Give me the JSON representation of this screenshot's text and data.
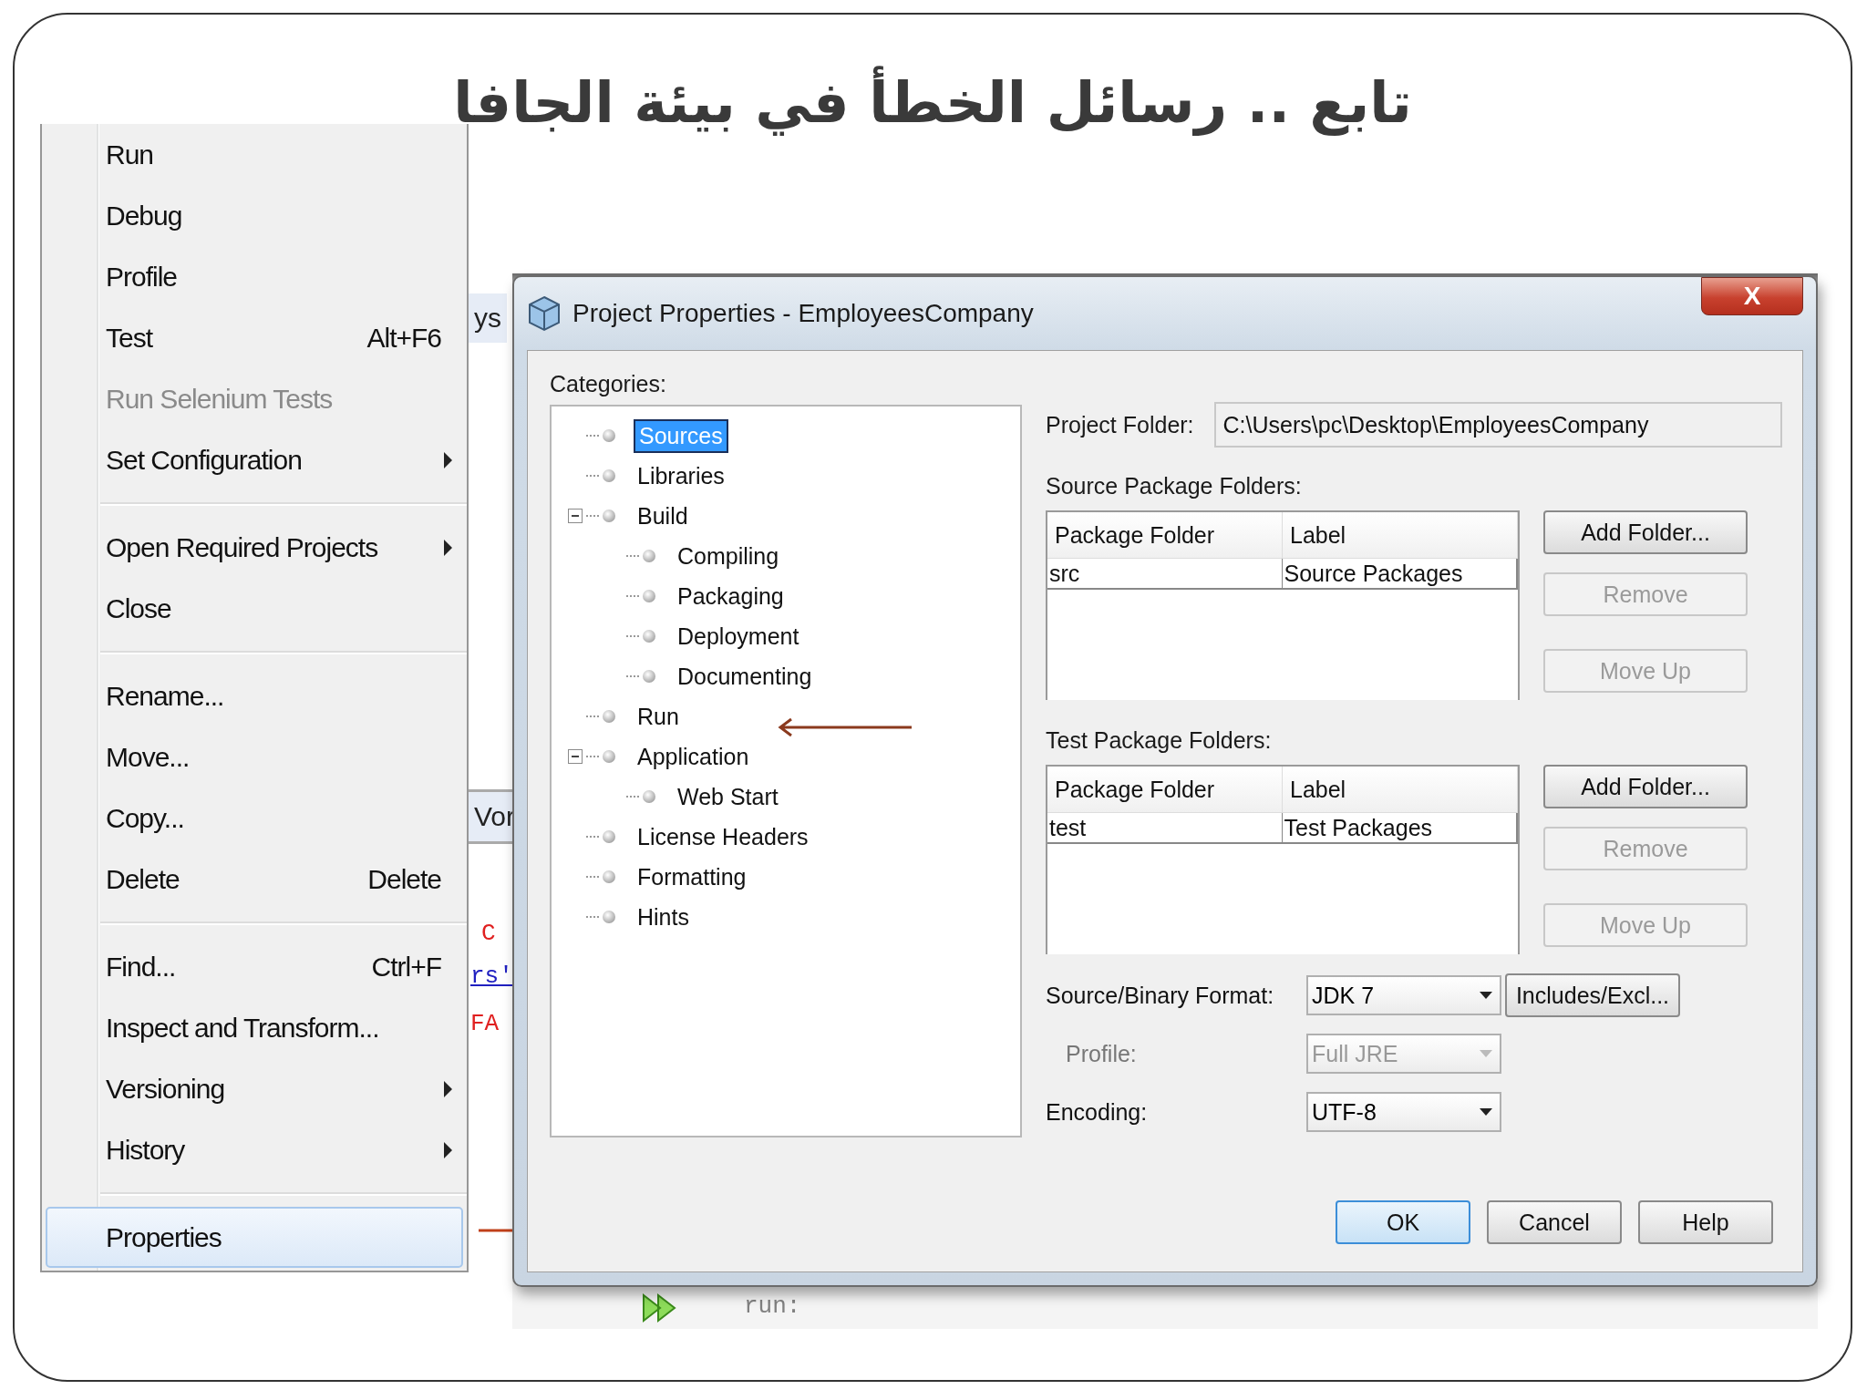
{
  "slide": {
    "title": "تابع .. رسائل الخطأ في بيئة الجافا"
  },
  "background_fragments": [
    {
      "kind": "tab",
      "text": "ys"
    },
    {
      "kind": "tab",
      "text": "Vor"
    },
    {
      "kind": "code",
      "text": "C",
      "color": "#e02020"
    },
    {
      "kind": "link",
      "text": "rs'",
      "color": "#2020c0"
    },
    {
      "kind": "code",
      "text": "FA",
      "color": "#e02020"
    },
    {
      "kind": "output",
      "text": "run:",
      "color": "#808080"
    }
  ],
  "context_menu": {
    "items": [
      {
        "kind": "item",
        "label": "Run",
        "disabled": false,
        "selected": false,
        "submenu": false
      },
      {
        "kind": "item",
        "label": "Debug",
        "disabled": false,
        "selected": false,
        "submenu": false
      },
      {
        "kind": "item",
        "label": "Profile",
        "disabled": false,
        "selected": false,
        "submenu": false
      },
      {
        "kind": "item",
        "label": "Test",
        "shortcut": "Alt+F6",
        "disabled": false,
        "selected": false,
        "submenu": false
      },
      {
        "kind": "item",
        "label": "Run Selenium Tests",
        "disabled": true,
        "selected": false,
        "submenu": false
      },
      {
        "kind": "item",
        "label": "Set Configuration",
        "disabled": false,
        "selected": false,
        "submenu": true
      },
      {
        "kind": "separator"
      },
      {
        "kind": "item",
        "label": "Open Required Projects",
        "disabled": false,
        "selected": false,
        "submenu": true
      },
      {
        "kind": "item",
        "label": "Close",
        "disabled": false,
        "selected": false,
        "submenu": false
      },
      {
        "kind": "separator"
      },
      {
        "kind": "item",
        "label": "Rename...",
        "disabled": false,
        "selected": false,
        "submenu": false
      },
      {
        "kind": "item",
        "label": "Move...",
        "disabled": false,
        "selected": false,
        "submenu": false
      },
      {
        "kind": "item",
        "label": "Copy...",
        "disabled": false,
        "selected": false,
        "submenu": false
      },
      {
        "kind": "item",
        "label": "Delete",
        "shortcut": "Delete",
        "disabled": false,
        "selected": false,
        "submenu": false
      },
      {
        "kind": "separator"
      },
      {
        "kind": "item",
        "label": "Find...",
        "shortcut": "Ctrl+F",
        "disabled": false,
        "selected": false,
        "submenu": false
      },
      {
        "kind": "item",
        "label": "Inspect and Transform...",
        "disabled": false,
        "selected": false,
        "submenu": false
      },
      {
        "kind": "item",
        "label": "Versioning",
        "disabled": false,
        "selected": false,
        "submenu": true
      },
      {
        "kind": "item",
        "label": "History",
        "disabled": false,
        "selected": false,
        "submenu": true
      },
      {
        "kind": "separator"
      },
      {
        "kind": "item",
        "label": "Properties",
        "disabled": false,
        "selected": true,
        "submenu": false
      }
    ]
  },
  "dialog": {
    "title": "Project Properties - EmployeesCompany",
    "close": "X",
    "categories_label": "Categories:",
    "categories": [
      {
        "label": "Sources",
        "selected": true,
        "expanded": false
      },
      {
        "label": "Libraries",
        "selected": false,
        "expanded": false
      },
      {
        "label": "Build",
        "selected": false,
        "expanded": true,
        "children": [
          {
            "label": "Compiling",
            "selected": false,
            "expanded": false
          },
          {
            "label": "Packaging",
            "selected": false,
            "expanded": false
          },
          {
            "label": "Deployment",
            "selected": false,
            "expanded": false
          },
          {
            "label": "Documenting",
            "selected": false,
            "expanded": false
          }
        ]
      },
      {
        "label": "Run",
        "selected": false,
        "expanded": false
      },
      {
        "label": "Application",
        "selected": false,
        "expanded": true,
        "children": [
          {
            "label": "Web Start",
            "selected": false,
            "expanded": false
          }
        ]
      },
      {
        "label": "License Headers",
        "selected": false,
        "expanded": false
      },
      {
        "label": "Formatting",
        "selected": false,
        "expanded": false
      },
      {
        "label": "Hints",
        "selected": false,
        "expanded": false
      }
    ],
    "project_folder": {
      "label": "Project Folder:",
      "value": "C:\\Users\\pc\\Desktop\\EmployeesCompany"
    },
    "folder_sections": [
      {
        "label": "Source Package Folders:",
        "columns": [
          "Package Folder",
          "Label"
        ],
        "rows": [
          [
            "src",
            "Source Packages"
          ]
        ],
        "buttons": [
          {
            "label": "Add Folder...",
            "disabled": false
          },
          {
            "label": "Remove",
            "disabled": true
          },
          {
            "label": "Move Up",
            "disabled": true
          }
        ]
      },
      {
        "label": "Test Package Folders:",
        "columns": [
          "Package Folder",
          "Label"
        ],
        "rows": [
          [
            "test",
            "Test Packages"
          ]
        ],
        "buttons": [
          {
            "label": "Add Folder...",
            "disabled": false
          },
          {
            "label": "Remove",
            "disabled": true
          },
          {
            "label": "Move Up",
            "disabled": true
          }
        ]
      }
    ],
    "settings": [
      {
        "label": "Source/Binary Format:",
        "value": "JDK 7",
        "disabled": false,
        "button": "Includes/Excl..."
      },
      {
        "label": "Profile:",
        "value": "Full JRE",
        "disabled": true
      },
      {
        "label": "Encoding:",
        "value": "UTF-8",
        "disabled": false
      }
    ],
    "buttons": [
      {
        "label": "OK",
        "default": true
      },
      {
        "label": "Cancel",
        "default": false
      },
      {
        "label": "Help",
        "default": false
      }
    ]
  }
}
